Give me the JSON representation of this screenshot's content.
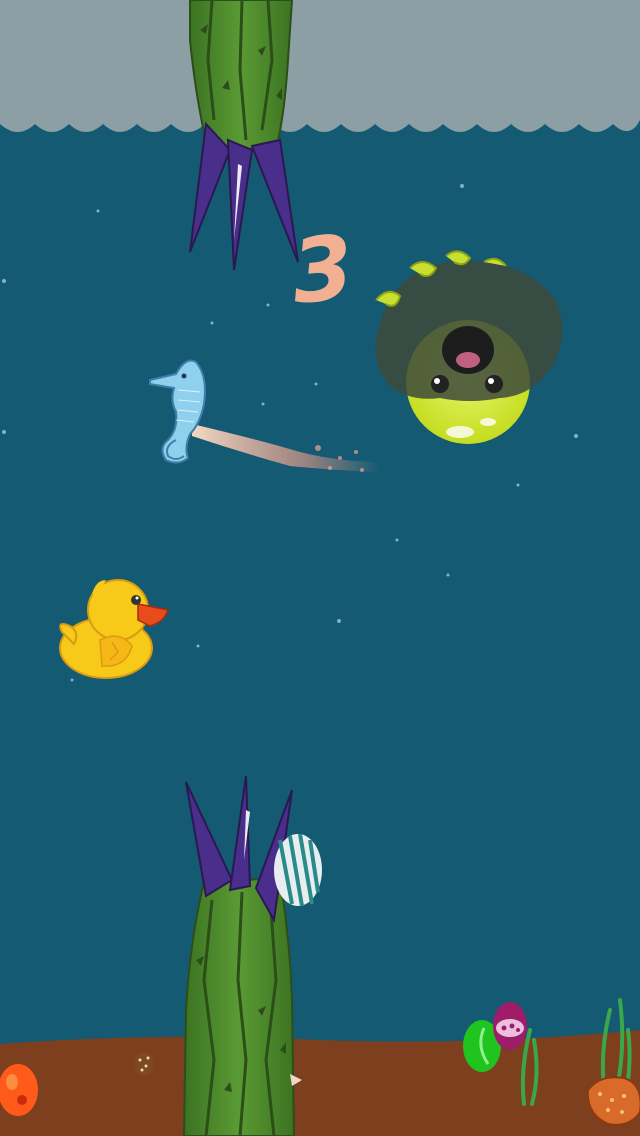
{
  "game": {
    "score": "3"
  },
  "colors": {
    "sky": "#8c9fa4",
    "water": "#145a73",
    "sand": "#7e3f1f",
    "pipe_green": "#4e8a2e",
    "pipe_spike": "#4a2e8c",
    "duck": "#f7c919",
    "duck_beak": "#e84c1a",
    "seahorse": "#7fc0e0",
    "monster": "#d9ec3a"
  },
  "sprites": {
    "player": "rubber-duck",
    "enemy_monster": "medusa-monster",
    "enemy_seahorse": "seahorse"
  }
}
